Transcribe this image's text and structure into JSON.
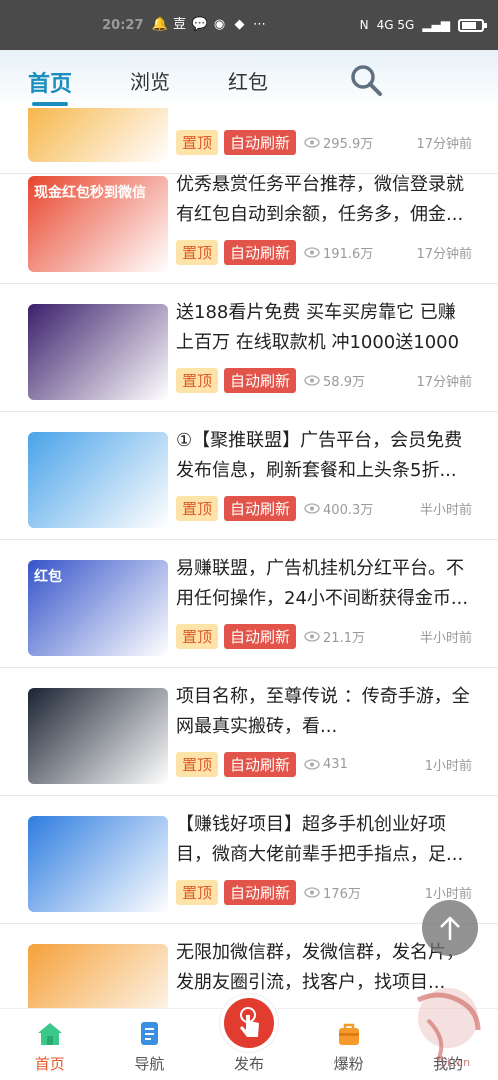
{
  "status_bar": {
    "time": "20:27",
    "network": "4G 5G",
    "icons": [
      "bell-icon",
      "app-icon",
      "wechat-icon",
      "message-icon",
      "app2-icon",
      "more-icon"
    ]
  },
  "top_tabs": [
    {
      "label": "首页",
      "active": true
    },
    {
      "label": "浏览",
      "active": false
    },
    {
      "label": "红包",
      "active": false
    }
  ],
  "accent_color": "#1a8fbf",
  "items": [
    {
      "title": "",
      "views": "295.9万",
      "time": "17分钟前",
      "tag_top": "置顶",
      "tag_refresh": "自动刷新",
      "thumb_color": "#f5a623"
    },
    {
      "title": "优秀悬赏任务平台推荐，微信登录就有红包自动到余额，任务多，佣金...",
      "views": "191.6万",
      "time": "17分钟前",
      "tag_top": "置顶",
      "tag_refresh": "自动刷新",
      "thumb_color": "#e8452c",
      "thumb_text": "现金红包秒到微信"
    },
    {
      "title": "送188看片免费 买车买房靠它 已赚上百万 在线取款机 冲1000送1000 ...",
      "views": "58.9万",
      "time": "17分钟前",
      "tag_top": "置顶",
      "tag_refresh": "自动刷新",
      "thumb_color": "#3b1f6b"
    },
    {
      "title": "①【聚推联盟】广告平台，会员免费发布信息，刷新套餐和上头条5折...",
      "views": "400.3万",
      "time": "半小时前",
      "tag_top": "置顶",
      "tag_refresh": "自动刷新",
      "thumb_color": "#4aa3e8"
    },
    {
      "title": "易赚联盟，广告机挂机分红平台。不用任何操作，24小不间断获得金币...",
      "views": "21.1万",
      "time": "半小时前",
      "tag_top": "置顶",
      "tag_refresh": "自动刷新",
      "thumb_color": "#3554c9",
      "thumb_text": "红包"
    },
    {
      "title": "项目名称，至尊传说 ：传奇手游，全网最真实搬砖，看...",
      "views": "431",
      "time": "1小时前",
      "tag_top": "置顶",
      "tag_refresh": "自动刷新",
      "thumb_color": "#1b2433"
    },
    {
      "title": "【赚钱好项目】超多手机创业好项目，微商大佬前辈手把手指点，足...",
      "views": "176万",
      "time": "1小时前",
      "tag_top": "置顶",
      "tag_refresh": "自动刷新",
      "thumb_color": "#2f7de0"
    },
    {
      "title": "无限加微信群，发微信群，发名片，发朋友圈引流，找客户，找项目...",
      "views": "",
      "time": "",
      "tag_top": "",
      "tag_refresh": "",
      "thumb_color": "#f5a13a"
    }
  ],
  "bottom_nav": [
    {
      "label": "首页",
      "icon": "home-icon",
      "active": true
    },
    {
      "label": "导航",
      "icon": "document-icon",
      "active": false
    },
    {
      "label": "发布",
      "icon": "publish-icon",
      "active": false
    },
    {
      "label": "爆粉",
      "icon": "bag-icon",
      "active": false
    },
    {
      "label": "我的",
      "icon": "user-icon",
      "active": false
    }
  ],
  "watermark_text": "5i..cn"
}
